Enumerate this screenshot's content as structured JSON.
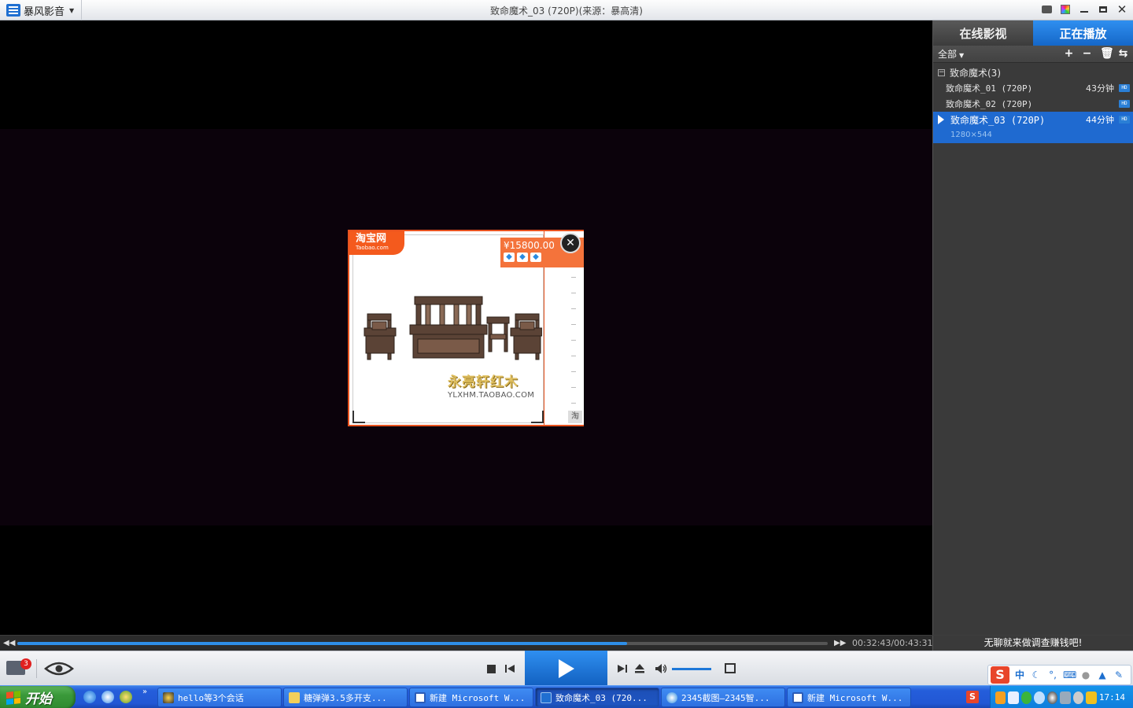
{
  "app": {
    "brand": "暴风影音",
    "window_title": "致命魔术_03 (720P)(来源：暴高清)"
  },
  "ad": {
    "site_logo": "淘宝网",
    "site_logo_sub": "Taobao.com",
    "price": "¥15800.00",
    "rating_gems": 3,
    "shop_name": "永亮轩红木",
    "shop_url": "YLXHM.TAOBAO.COM",
    "tao_mark": "淘"
  },
  "panel": {
    "tabs": [
      {
        "label": "在线影视",
        "active": false
      },
      {
        "label": "正在播放",
        "active": true
      }
    ],
    "filter": "全部",
    "group": {
      "label": "致命魔术(3)",
      "toggle": "−"
    },
    "items": [
      {
        "title": "致命魔术_01 (720P)",
        "duration": "43分钟",
        "hd": "HD"
      },
      {
        "title": "致命魔术_02 (720P)",
        "duration": "",
        "hd": "HD"
      },
      {
        "title": "致命魔术_03 (720P)",
        "duration": "44分钟",
        "hd": "HD",
        "resolution": "1280×544"
      }
    ]
  },
  "player": {
    "time": "00:32:43/00:43:31",
    "progress": 0.752,
    "volume": 1.0,
    "promo": "无聊就来做调查赚钱吧!",
    "toolbox_badge": "3"
  },
  "ime": {
    "logo": "S",
    "mode": "中"
  },
  "taskbar": {
    "start": "开始",
    "quicklaunch_more": "»",
    "tasks": [
      {
        "label": "hello等3个会话",
        "active": false
      },
      {
        "label": "糖弹弹3.5多开支...",
        "active": false
      },
      {
        "label": "新建 Microsoft W...",
        "active": false
      },
      {
        "label": "致命魔术_03 (720...",
        "active": true
      },
      {
        "label": "2345截图—2345智...",
        "active": false
      },
      {
        "label": "新建 Microsoft W...",
        "active": false
      }
    ],
    "clock": "17:14"
  },
  "colors": {
    "accent": "#1f6ad0",
    "taobao_orange": "#f45a1d"
  }
}
